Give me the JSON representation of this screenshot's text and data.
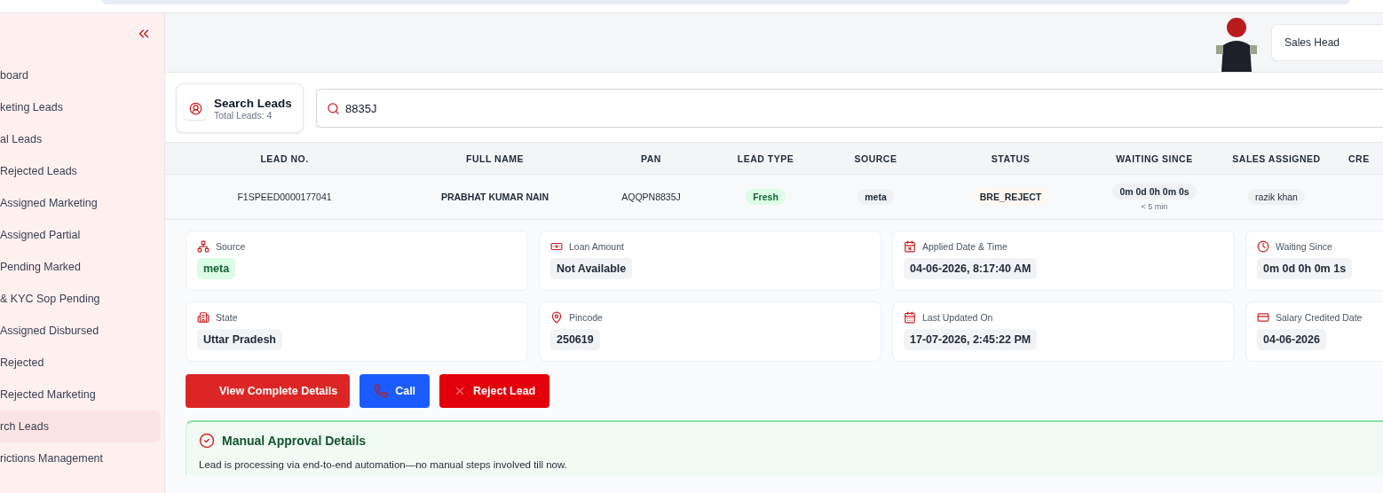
{
  "sidebar": {
    "items": [
      {
        "label": "board",
        "selected": false
      },
      {
        "label": "keting Leads",
        "selected": false
      },
      {
        "label": "al Leads",
        "selected": false
      },
      {
        "label": "Rejected Leads",
        "selected": false
      },
      {
        "label": "Assigned Marketing",
        "selected": false
      },
      {
        "label": "Assigned Partial",
        "selected": false
      },
      {
        "label": "Pending Marked",
        "selected": false
      },
      {
        "label": "& KYC Sop Pending",
        "selected": false
      },
      {
        "label": "Assigned Disbursed",
        "selected": false
      },
      {
        "label": "Rejected",
        "selected": false
      },
      {
        "label": "Rejected Marketing",
        "selected": false
      },
      {
        "label": "rch Leads",
        "selected": true
      },
      {
        "label": "rictions Management",
        "selected": false
      }
    ]
  },
  "header": {
    "role_select": "Sales Head"
  },
  "search_card": {
    "title": "Search Leads",
    "subtitle": "Total Leads: 4"
  },
  "search": {
    "value": "8835J"
  },
  "table": {
    "columns": [
      "LEAD NO.",
      "FULL NAME",
      "PAN",
      "LEAD TYPE",
      "SOURCE",
      "STATUS",
      "WAITING SINCE",
      "SALES ASSIGNED",
      "CRE"
    ],
    "rows": [
      {
        "lead_no": "F1SPEED0000177041",
        "full_name": "PRABHAT KUMAR NAIN",
        "pan": "AQQPN8835J",
        "lead_type": "Fresh",
        "source": "meta",
        "status": "BRE_REJECT",
        "waiting": "0m 0d 0h 0m 0s",
        "waiting_note": "< 5 min",
        "sales_assigned": "razik khan"
      }
    ]
  },
  "details": [
    {
      "kind": "source",
      "label": "Source",
      "value": "meta"
    },
    {
      "kind": "loan",
      "label": "Loan Amount",
      "value": "Not Available"
    },
    {
      "kind": "applied",
      "label": "Applied Date & Time",
      "value": "04-06-2026, 8:17:40 AM"
    },
    {
      "kind": "waiting",
      "label": "Waiting Since",
      "value": "0m 0d 0h 0m 1s"
    },
    {
      "kind": "state",
      "label": "State",
      "value": "Uttar Pradesh"
    },
    {
      "kind": "pincode",
      "label": "Pincode",
      "value": "250619"
    },
    {
      "kind": "updated",
      "label": "Last Updated On",
      "value": "17-07-2026, 2:45:22 PM"
    },
    {
      "kind": "salary",
      "label": "Salary Credited Date",
      "value": "04-06-2026"
    }
  ],
  "actions": [
    {
      "kind": "view",
      "label": "View Complete Details"
    },
    {
      "kind": "call",
      "label": "Call"
    },
    {
      "kind": "reject",
      "label": "Reject Lead"
    }
  ],
  "manual_approval": {
    "title": "Manual Approval Details",
    "text": "Lead is processing via end-to-end automation—no manual steps involved till now."
  }
}
